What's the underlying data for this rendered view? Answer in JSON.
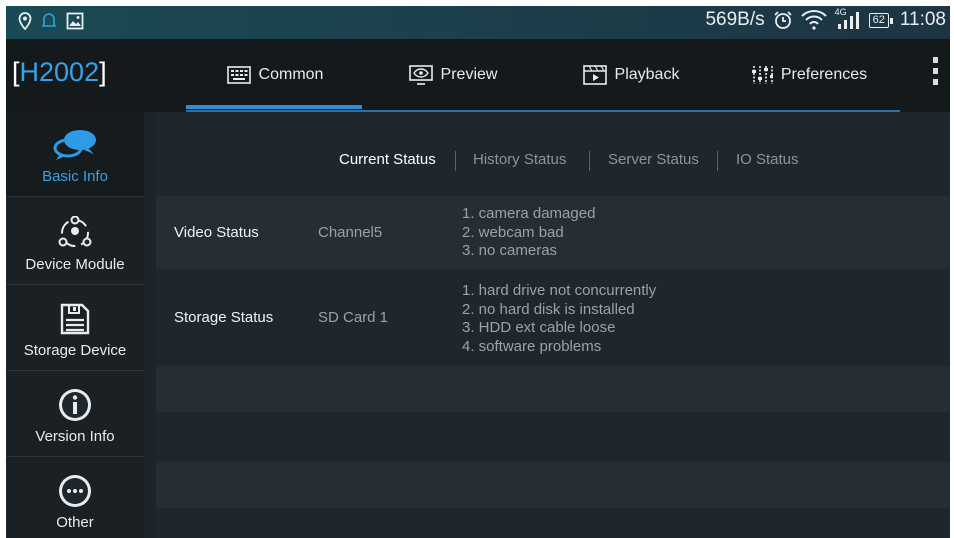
{
  "status_bar": {
    "left_icons": [
      "location-icon",
      "notification-icon",
      "gallery-icon"
    ],
    "speed": "569B/s",
    "network": "4G",
    "battery": "62",
    "time": "11:08"
  },
  "app": {
    "logo_bracket_open": "[",
    "logo_text": "H2002",
    "logo_bracket_close": "]"
  },
  "tabs": [
    {
      "label": "Common",
      "icon": "keyboard-icon"
    },
    {
      "label": "Preview",
      "icon": "monitor-eye-icon"
    },
    {
      "label": "Playback",
      "icon": "film-play-icon"
    },
    {
      "label": "Preferences",
      "icon": "sliders-icon"
    }
  ],
  "sidebar": {
    "items": [
      {
        "label": "Basic Info",
        "icon": "chat-bubble-icon"
      },
      {
        "label": "Device Module",
        "icon": "module-icon"
      },
      {
        "label": "Storage Device",
        "icon": "floppy-disk-icon"
      },
      {
        "label": "Version Info",
        "icon": "info-icon"
      },
      {
        "label": "Other",
        "icon": "more-dots-icon"
      }
    ]
  },
  "subtabs": [
    "Current Status",
    "History Status",
    "Server Status",
    "IO Status"
  ],
  "rows": [
    {
      "label": "Video Status",
      "value": "Channel5",
      "details": [
        "1. camera damaged",
        "2. webcam bad",
        "3. no cameras"
      ]
    },
    {
      "label": "Storage Status",
      "value": "SD Card 1",
      "details": [
        "1. hard drive not concurrently",
        "2. no hard disk is installed",
        "3. HDD ext cable loose",
        "4. software problems"
      ]
    }
  ],
  "colors": {
    "accent": "#3aa0e8",
    "background": "#20272c",
    "header": "#14191c",
    "statusbar": "#1a4a55"
  }
}
